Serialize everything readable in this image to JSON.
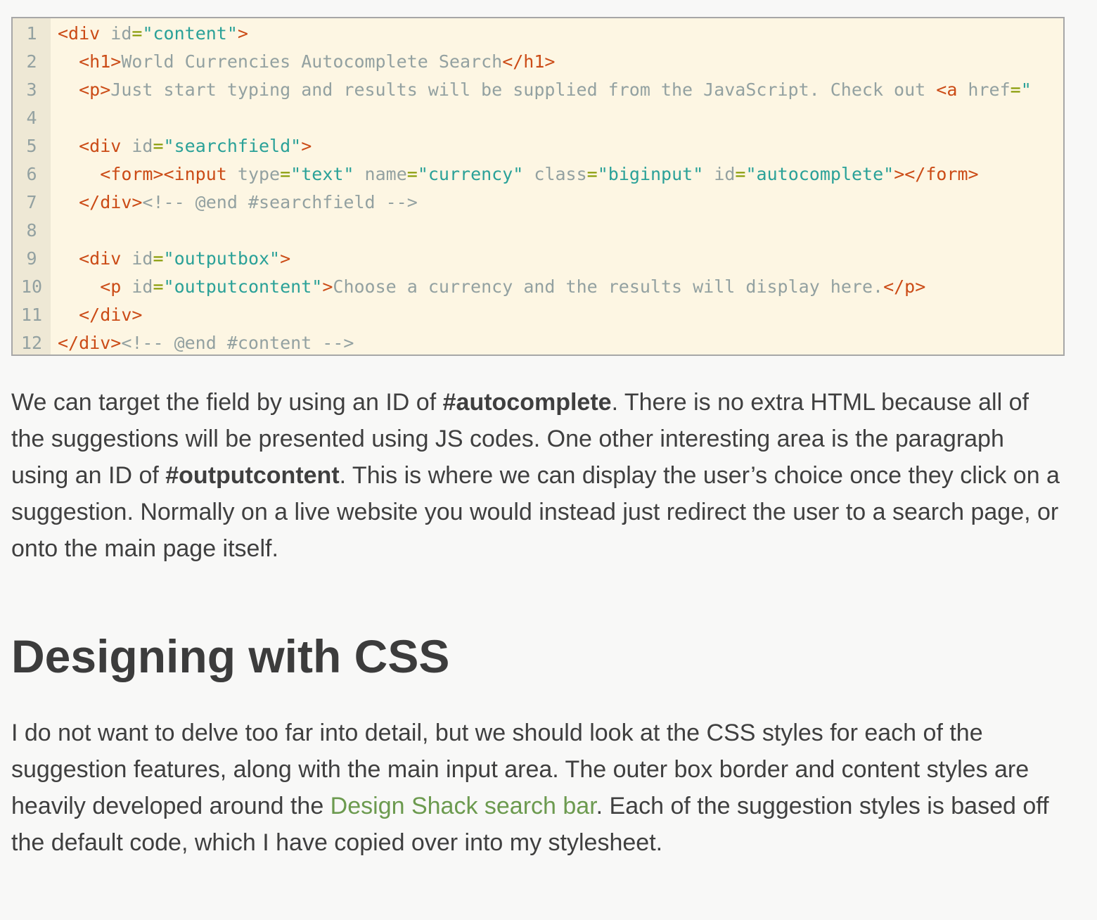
{
  "code_block": {
    "lines": [
      {
        "n": "1",
        "parts": [
          [
            "tag",
            "<div "
          ],
          [
            "attr",
            "id"
          ],
          [
            "eq",
            "="
          ],
          [
            "str",
            "\"content\""
          ],
          [
            "tag",
            ">"
          ]
        ]
      },
      {
        "n": "2",
        "parts": [
          [
            "txt",
            "  "
          ],
          [
            "tag",
            "<h1>"
          ],
          [
            "txt",
            "World Currencies Autocomplete Search"
          ],
          [
            "tag",
            "</h1>"
          ]
        ]
      },
      {
        "n": "3",
        "parts": [
          [
            "txt",
            "  "
          ],
          [
            "tag",
            "<p>"
          ],
          [
            "txt",
            "Just start typing and results will be supplied from the JavaScript. Check out "
          ],
          [
            "tag",
            "<a "
          ],
          [
            "attr",
            "href"
          ],
          [
            "eq",
            "="
          ],
          [
            "str",
            "\""
          ]
        ]
      },
      {
        "n": "4",
        "parts": []
      },
      {
        "n": "5",
        "parts": [
          [
            "txt",
            "  "
          ],
          [
            "tag",
            "<div "
          ],
          [
            "attr",
            "id"
          ],
          [
            "eq",
            "="
          ],
          [
            "str",
            "\"searchfield\""
          ],
          [
            "tag",
            ">"
          ]
        ]
      },
      {
        "n": "6",
        "parts": [
          [
            "txt",
            "    "
          ],
          [
            "tag",
            "<form><input "
          ],
          [
            "attr",
            "type"
          ],
          [
            "eq",
            "="
          ],
          [
            "str",
            "\"text\""
          ],
          [
            "txt",
            " "
          ],
          [
            "attr",
            "name"
          ],
          [
            "eq",
            "="
          ],
          [
            "str",
            "\"currency\""
          ],
          [
            "txt",
            " "
          ],
          [
            "attr",
            "class"
          ],
          [
            "eq",
            "="
          ],
          [
            "str",
            "\"biginput\""
          ],
          [
            "txt",
            " "
          ],
          [
            "attr",
            "id"
          ],
          [
            "eq",
            "="
          ],
          [
            "str",
            "\"autocomplete\""
          ],
          [
            "tag",
            "></form>"
          ]
        ]
      },
      {
        "n": "7",
        "parts": [
          [
            "txt",
            "  "
          ],
          [
            "tag",
            "</div>"
          ],
          [
            "cmt",
            "<!-- @end #searchfield -->"
          ]
        ]
      },
      {
        "n": "8",
        "parts": []
      },
      {
        "n": "9",
        "parts": [
          [
            "txt",
            "  "
          ],
          [
            "tag",
            "<div "
          ],
          [
            "attr",
            "id"
          ],
          [
            "eq",
            "="
          ],
          [
            "str",
            "\"outputbox\""
          ],
          [
            "tag",
            ">"
          ]
        ]
      },
      {
        "n": "10",
        "parts": [
          [
            "txt",
            "    "
          ],
          [
            "tag",
            "<p "
          ],
          [
            "attr",
            "id"
          ],
          [
            "eq",
            "="
          ],
          [
            "str",
            "\"outputcontent\""
          ],
          [
            "tag",
            ">"
          ],
          [
            "txt",
            "Choose a currency and the results will display here."
          ],
          [
            "tag",
            "</p>"
          ]
        ]
      },
      {
        "n": "11",
        "parts": [
          [
            "txt",
            "  "
          ],
          [
            "tag",
            "</div>"
          ]
        ]
      },
      {
        "n": "12",
        "parts": [
          [
            "tag",
            "</div>"
          ],
          [
            "cmt",
            "<!-- @end #content -->"
          ]
        ]
      }
    ]
  },
  "paragraph1": {
    "t1": "We can target the field by using an ID of ",
    "b1": "#autocomplete",
    "t2": ". There is no extra HTML because all of the suggestions will be presented using JS codes. One other interesting area is the paragraph using an ID of ",
    "b2": "#outputcontent",
    "t3": ". This is where we can display the user’s choice once they click on a suggestion. Normally on a live website you would instead just redirect the user to a search page, or onto the main page itself."
  },
  "heading": "Designing with CSS",
  "paragraph2": {
    "t1": "I do not want to delve too far into detail, but we should look at the CSS styles for each of the suggestion features, along with the main input area. The outer box border and content styles are heavily developed around the ",
    "link": "Design Shack search bar",
    "t2": ". Each of the suggestion styles is based off the default code, which I have copied over into my stylesheet."
  },
  "colors": {
    "code_bg": "#fdf6e3",
    "gutter_bg": "#eee8d5",
    "tag": "#cb4b16",
    "attr": "#93a1a1",
    "equals": "#859900",
    "string": "#2aa198",
    "link": "#6c9a4f",
    "text": "#3f3f3f"
  }
}
